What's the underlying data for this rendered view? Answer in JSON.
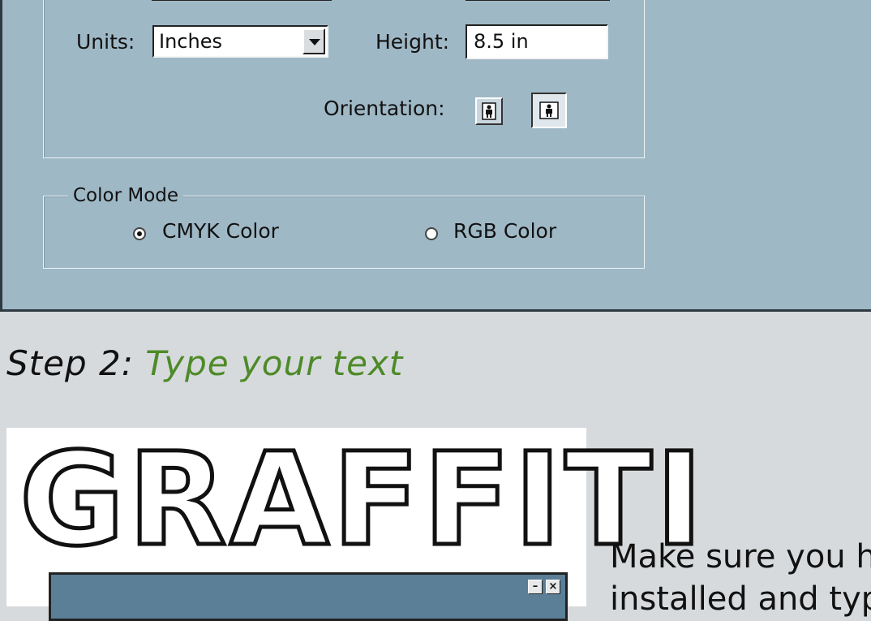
{
  "dialog": {
    "units_label": "Units:",
    "units_value": "Inches",
    "height_label": "Height:",
    "height_value": "8.5 in",
    "orientation_label": "Orientation:",
    "color_mode": {
      "legend": "Color Mode",
      "cmyk_label": "CMYK Color",
      "rgb_label": "RGB Color",
      "selected": "CMYK Color"
    }
  },
  "step": {
    "number_label": "Step 2:",
    "title": "Type your text"
  },
  "graffiti": {
    "word": "GRAFFITI",
    "window_buttons": [
      "minimize-button",
      "close-button"
    ]
  },
  "note": {
    "line1": "Make sure you h",
    "line2": "installed and typ"
  }
}
